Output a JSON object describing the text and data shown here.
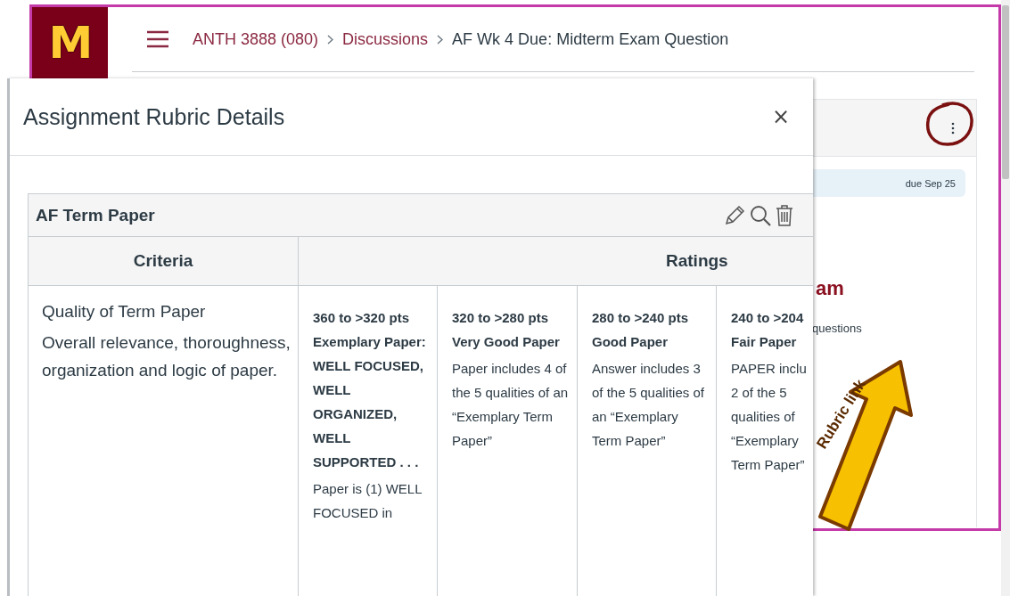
{
  "logo": {
    "text": "M"
  },
  "breadcrumbs": [
    {
      "label": "ANTH 3888 (080)",
      "kind": "link"
    },
    {
      "label": "Discussions",
      "kind": "link"
    },
    {
      "label": "AF Wk 4 Due: Midterm Exam Question",
      "kind": "current"
    }
  ],
  "side_panel": {
    "due": "due Sep 25",
    "heading": "am",
    "text": "questions"
  },
  "dialog": {
    "title": "Assignment Rubric Details",
    "close": "×",
    "rubric": {
      "title": "AF Term Paper",
      "columns": [
        "Criteria",
        "Ratings"
      ],
      "criterion": {
        "name": "Quality of Term Paper",
        "description": "Overall relevance, thoroughness, organization and logic of paper."
      },
      "ratings": [
        {
          "points": "360 to >320 pts",
          "title": "Exemplary Paper: WELL FOCUSED, WELL ORGANIZED, WELL SUPPORTED . . .",
          "description": "Paper is (1) WELL FOCUSED in"
        },
        {
          "points": "320 to >280 pts",
          "title": "Very Good Paper",
          "description": "Paper includes 4 of the 5 qualities of an “Exemplary Term Paper”"
        },
        {
          "points": "280 to >240 pts",
          "title": "Good Paper",
          "description": "Answer includes 3 of the 5 qualities of an “Exemplary Term Paper”"
        },
        {
          "points": "240 to >204",
          "title": "Fair Paper",
          "description": "PAPER inclu\n2 of the 5\nqualities of\n“Exemplary\nTerm Paper”"
        }
      ]
    }
  },
  "annotation": {
    "label": "Rubric link"
  }
}
